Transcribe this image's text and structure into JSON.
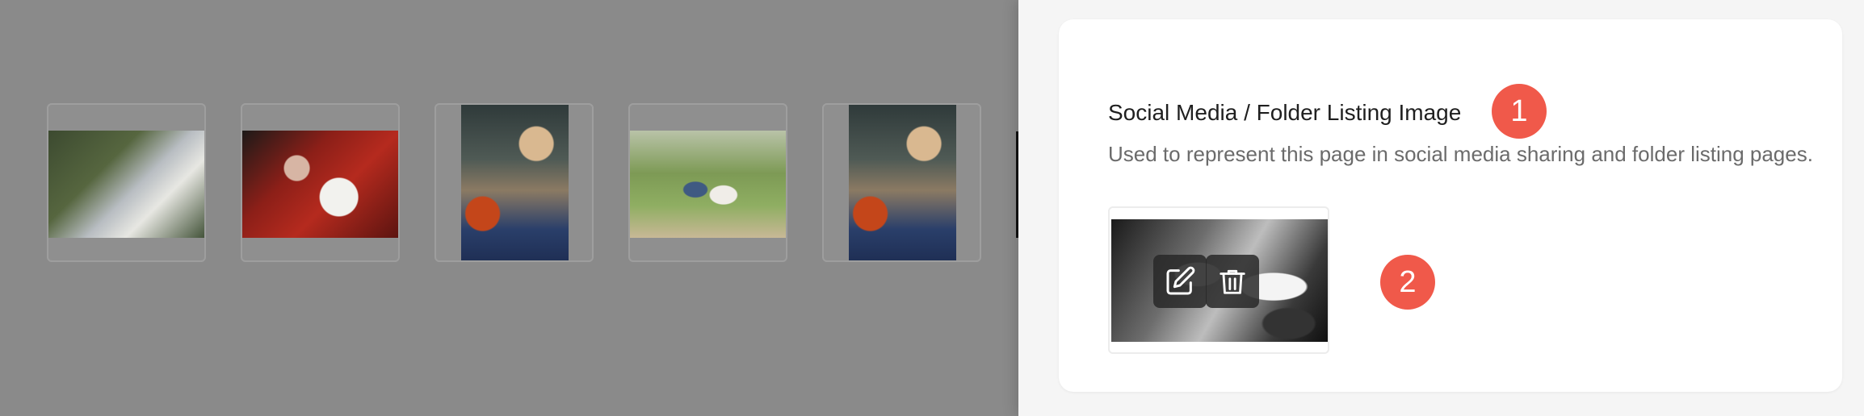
{
  "gallery": {
    "thumbnails": [
      {
        "name": "bride-veil",
        "orientation": "landscape"
      },
      {
        "name": "red-dress-bouquet",
        "orientation": "landscape"
      },
      {
        "name": "bride-in-car",
        "orientation": "portrait"
      },
      {
        "name": "couple-walking",
        "orientation": "landscape"
      },
      {
        "name": "bride-in-car",
        "orientation": "portrait"
      }
    ]
  },
  "social_image": {
    "title": "Social Media / Folder Listing Image",
    "description": "Used to represent this page in social media sharing and folder listing pages.",
    "actions": {
      "edit_icon": "pencil-square-icon",
      "delete_icon": "trash-icon"
    }
  },
  "annotations": {
    "badge_1": "1",
    "badge_2": "2"
  },
  "colors": {
    "badge": "#f0594a",
    "backdrop": "#8a8a8a",
    "panel": "#f5f5f5",
    "card": "#ffffff"
  }
}
